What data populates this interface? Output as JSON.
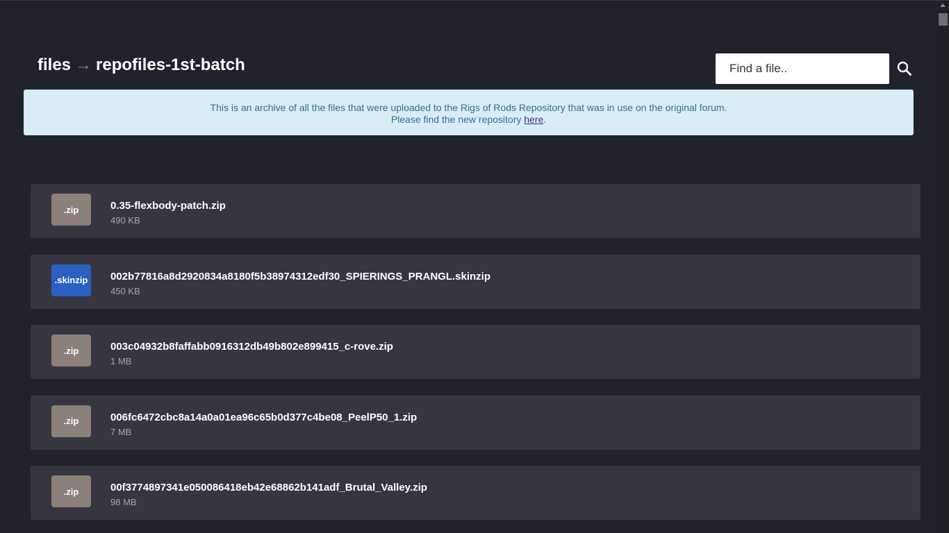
{
  "breadcrumb": {
    "root": "files",
    "separator": "→",
    "current": "repofiles-1st-batch"
  },
  "search": {
    "placeholder": "Find a file..",
    "icon": "search-icon"
  },
  "notice": {
    "line1": "This is an archive of all the files that were uploaded to the Rigs of Rods Repository that was in use on the original forum.",
    "line2_prefix": "Please find the new repository ",
    "link_text": "here",
    "line2_suffix": "."
  },
  "colors": {
    "zip_badge": "#8c8078",
    "skinzip_badge": "#2b5fc1"
  },
  "files": [
    {
      "ext": ".zip",
      "name": "0.35-flexbody-patch.zip",
      "size": "490 KB"
    },
    {
      "ext": ".skinzip",
      "name": "002b77816a8d2920834a8180f5b38974312edf30_SPIERINGS_PRANGL.skinzip",
      "size": "450 KB"
    },
    {
      "ext": ".zip",
      "name": "003c04932b8faffabb0916312db49b802e899415_c-rove.zip",
      "size": "1 MB"
    },
    {
      "ext": ".zip",
      "name": "006fc6472cbc8a14a0a01ea96c65b0d377c4be08_PeelP50_1.zip",
      "size": "7 MB"
    },
    {
      "ext": ".zip",
      "name": "00f3774897341e050086418eb42e68862b141adf_Brutal_Valley.zip",
      "size": "98 MB"
    }
  ]
}
